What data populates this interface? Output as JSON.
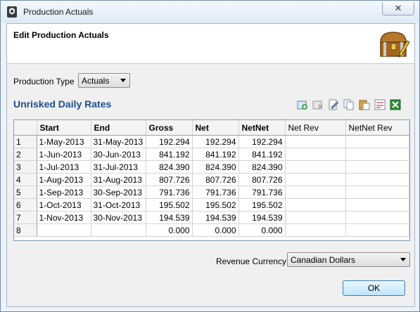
{
  "window": {
    "title": "Production Actuals",
    "close_label": "✕"
  },
  "header": {
    "title": "Edit Production Actuals"
  },
  "production_type": {
    "label": "Production Type",
    "selected": "Actuals"
  },
  "section": {
    "title": "Unrisked Daily Rates"
  },
  "toolbar": {
    "icons": [
      "add-row-icon",
      "delete-row-icon",
      "edit-icon",
      "copy-icon",
      "paste-icon",
      "calculate-icon",
      "excel-export-icon"
    ]
  },
  "table": {
    "headers": [
      "Start",
      "End",
      "Gross",
      "Net",
      "NetNet",
      "Net Rev",
      "NetNet Rev"
    ],
    "rows": [
      {
        "num": "1",
        "start": "1-May-2013",
        "end": "31-May-2013",
        "gross": "192.294",
        "net": "192.294",
        "netnet": "192.294",
        "netrev": "",
        "netnetrev": ""
      },
      {
        "num": "2",
        "start": "1-Jun-2013",
        "end": "30-Jun-2013",
        "gross": "841.192",
        "net": "841.192",
        "netnet": "841.192",
        "netrev": "",
        "netnetrev": ""
      },
      {
        "num": "3",
        "start": "1-Jul-2013",
        "end": "31-Jul-2013",
        "gross": "824.390",
        "net": "824.390",
        "netnet": "824.390",
        "netrev": "",
        "netnetrev": ""
      },
      {
        "num": "4",
        "start": "1-Aug-2013",
        "end": "31-Aug-2013",
        "gross": "807.726",
        "net": "807.726",
        "netnet": "807.726",
        "netrev": "",
        "netnetrev": ""
      },
      {
        "num": "5",
        "start": "1-Sep-2013",
        "end": "30-Sep-2013",
        "gross": "791.736",
        "net": "791.736",
        "netnet": "791.736",
        "netrev": "",
        "netnetrev": ""
      },
      {
        "num": "6",
        "start": "1-Oct-2013",
        "end": "31-Oct-2013",
        "gross": "195.502",
        "net": "195.502",
        "netnet": "195.502",
        "netrev": "",
        "netnetrev": ""
      },
      {
        "num": "7",
        "start": "1-Nov-2013",
        "end": "30-Nov-2013",
        "gross": "194.539",
        "net": "194.539",
        "netnet": "194.539",
        "netrev": "",
        "netnetrev": ""
      },
      {
        "num": "8",
        "start": "",
        "end": "",
        "gross": "0.000",
        "net": "0.000",
        "netnet": "0.000",
        "netrev": "",
        "netnetrev": ""
      }
    ]
  },
  "revenue_currency": {
    "label": "Revenue Currency",
    "selected": "Canadian Dollars"
  },
  "ok_button": {
    "label": "OK"
  }
}
